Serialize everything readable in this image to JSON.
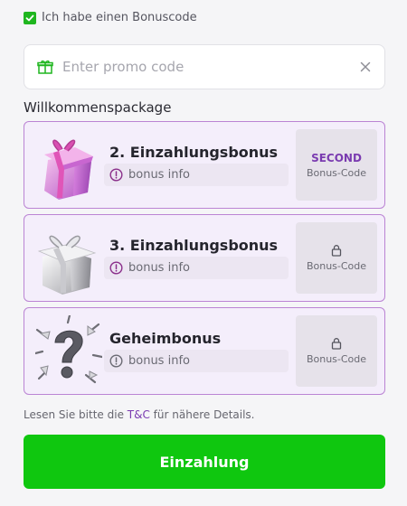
{
  "bonus_checkbox": {
    "checked": true,
    "label": "Ich habe einen Bonuscode"
  },
  "promo": {
    "placeholder": "Enter promo code",
    "value": ""
  },
  "section_title": "Willkommenspackage",
  "bonuses": [
    {
      "name": "2. Einzahlungsbonus",
      "info": "bonus info",
      "code": "SECOND",
      "code_label": "Bonus-Code",
      "locked": false
    },
    {
      "name": "3. Einzahlungsbonus",
      "info": "bonus info",
      "code": "",
      "code_label": "Bonus-Code",
      "locked": true
    },
    {
      "name": "Geheimbonus",
      "info": "bonus info",
      "code": "",
      "code_label": "Bonus-Code",
      "locked": true
    }
  ],
  "note": {
    "prefix": "Lesen Sie bitte die ",
    "link": "T&C",
    "suffix": " für nähere Details."
  },
  "deposit_button": "Einzahlung",
  "colors": {
    "accent_green": "#0fc70f",
    "accent_purple": "#7a3bb0",
    "card_border": "#bb84d4"
  }
}
